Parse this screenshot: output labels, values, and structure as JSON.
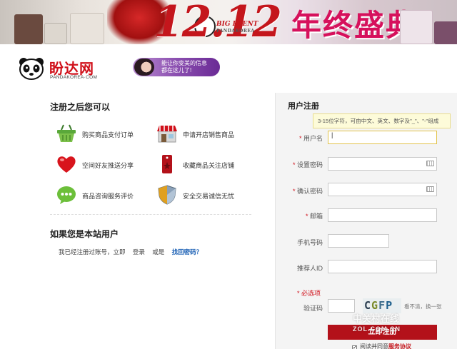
{
  "banner": {
    "number": "12.12",
    "event_line1": "BIG EVENT",
    "event_line2": "PANDAKOREA",
    "title": "年终盛典"
  },
  "header": {
    "logo_name": "盼达网",
    "logo_sub": "PANDAKOREA·COM",
    "promo_line1": "能让你变美的信息",
    "promo_line2": "都在这儿了!"
  },
  "left": {
    "benefits_title": "注册之后您可以",
    "features": [
      {
        "label": "购买商品支付订单",
        "icon": "shopping-basket-icon"
      },
      {
        "label": "申请开店销售商品",
        "icon": "storefront-icon"
      },
      {
        "label": "空间好友推送分享",
        "icon": "heart-icon"
      },
      {
        "label": "收藏商品关注店铺",
        "icon": "bookmark-tag-icon"
      },
      {
        "label": "商品咨询服务评价",
        "icon": "chat-bubble-icon"
      },
      {
        "label": "安全交易诚信无忧",
        "icon": "shield-icon"
      }
    ],
    "member_title": "如果您是本站用户",
    "login_prompt": "我已经注册过账号，立即",
    "login_link": "登录",
    "or_text": "或是",
    "forgot_link": "找回密码？"
  },
  "form": {
    "title": "用户注册",
    "tip": "3-15位字符，可由中文、英文、数字及\"_\"、\"-\"组成",
    "required_mark": "*",
    "username_label": "用户名",
    "password_label": "设置密码",
    "confirm_label": "确认密码",
    "email_label": "邮箱",
    "phone_label": "手机号码",
    "referrer_label": "推荐人ID",
    "optional_title": "* 必选项",
    "captcha_label": "验证码",
    "captcha_chars": [
      "C",
      "G",
      "F",
      "P"
    ],
    "refresh_text": "看不清，换一张",
    "submit_label": "立即注册",
    "agree_text": "阅读并同意",
    "agree_link": "服务协议",
    "agree_checked": "✓"
  },
  "watermark": {
    "line1": "中关村在线",
    "line2": "ZOL.COM.CN"
  },
  "colors": {
    "brand_red": "#d0101a",
    "banner_pink": "#d6115c",
    "form_bg": "#f4f4f4",
    "link_blue": "#1a5fb4"
  }
}
